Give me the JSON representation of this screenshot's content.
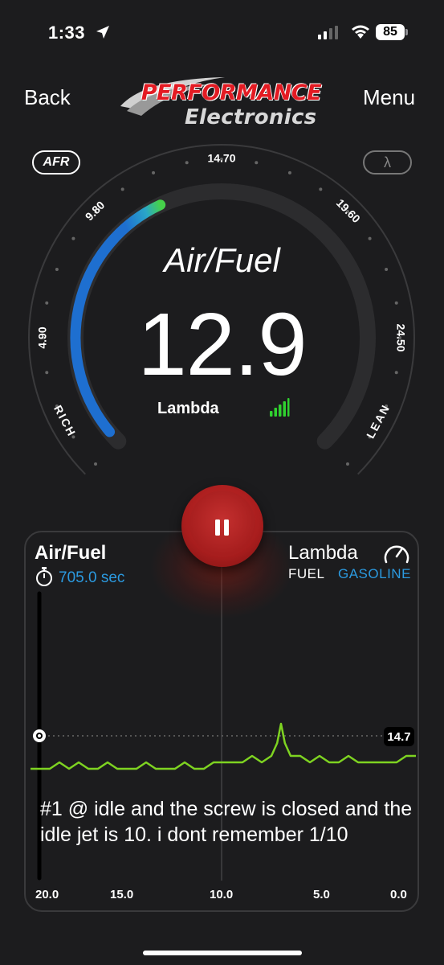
{
  "status": {
    "time": "1:33",
    "battery": "85"
  },
  "nav": {
    "back": "Back",
    "menu": "Menu"
  },
  "logo": {
    "main": "PERFORMANCE",
    "sub": "Electronics"
  },
  "mode": {
    "afr": "AFR",
    "lambda": "λ"
  },
  "gauge": {
    "title": "Air/Fuel",
    "value": "12.9",
    "sub_label": "Lambda",
    "ticks": [
      "4.90",
      "9.80",
      "14.70",
      "19.60",
      "24.50"
    ],
    "rich": "RICH",
    "lean": "LEAN",
    "min": 4.9,
    "max": 24.5,
    "current": 12.9,
    "arc_color": "#1e6fd0",
    "arc_end_color": "#46d14a",
    "signal_color": "#2fd12f"
  },
  "chart": {
    "title": "Air/Fuel",
    "timer": "705.0 sec",
    "lambda_label": "Lambda",
    "fuel_label": "FUEL",
    "fuel_value": "GASOLINE",
    "ref_value": "14.7",
    "x_labels": [
      "20.0",
      "15.0",
      "10.0",
      "5.0",
      "0.0"
    ],
    "line_color": "#7ed321",
    "accent_color": "#2b9ae0"
  },
  "chart_data": {
    "type": "line",
    "x": [
      20,
      19.5,
      19,
      18.5,
      18,
      17.5,
      17,
      16.5,
      16,
      15.5,
      15,
      14.5,
      14,
      13.5,
      13,
      12.5,
      12,
      11.5,
      11,
      10.5,
      10,
      9.5,
      9,
      8.5,
      8,
      7.5,
      7.2,
      7,
      6.8,
      6.5,
      6,
      5.5,
      5,
      4.5,
      4,
      3.5,
      3,
      2.5,
      2,
      1.5,
      1,
      0.5,
      0
    ],
    "values": [
      14.5,
      14.5,
      14.5,
      14.6,
      14.5,
      14.6,
      14.5,
      14.5,
      14.6,
      14.5,
      14.5,
      14.5,
      14.6,
      14.5,
      14.5,
      14.5,
      14.6,
      14.5,
      14.5,
      14.6,
      14.6,
      14.6,
      14.6,
      14.7,
      14.6,
      14.7,
      14.9,
      15.2,
      14.9,
      14.7,
      14.7,
      14.6,
      14.7,
      14.6,
      14.6,
      14.7,
      14.6,
      14.6,
      14.6,
      14.6,
      14.6,
      14.7,
      14.7
    ],
    "xlabel": "",
    "ylabel": "",
    "ref_line": 14.7,
    "xlim": [
      20,
      0
    ]
  },
  "annotation": "#1 @ idle and the screw is closed and the idle jet is 10. i dont remember 1/10"
}
